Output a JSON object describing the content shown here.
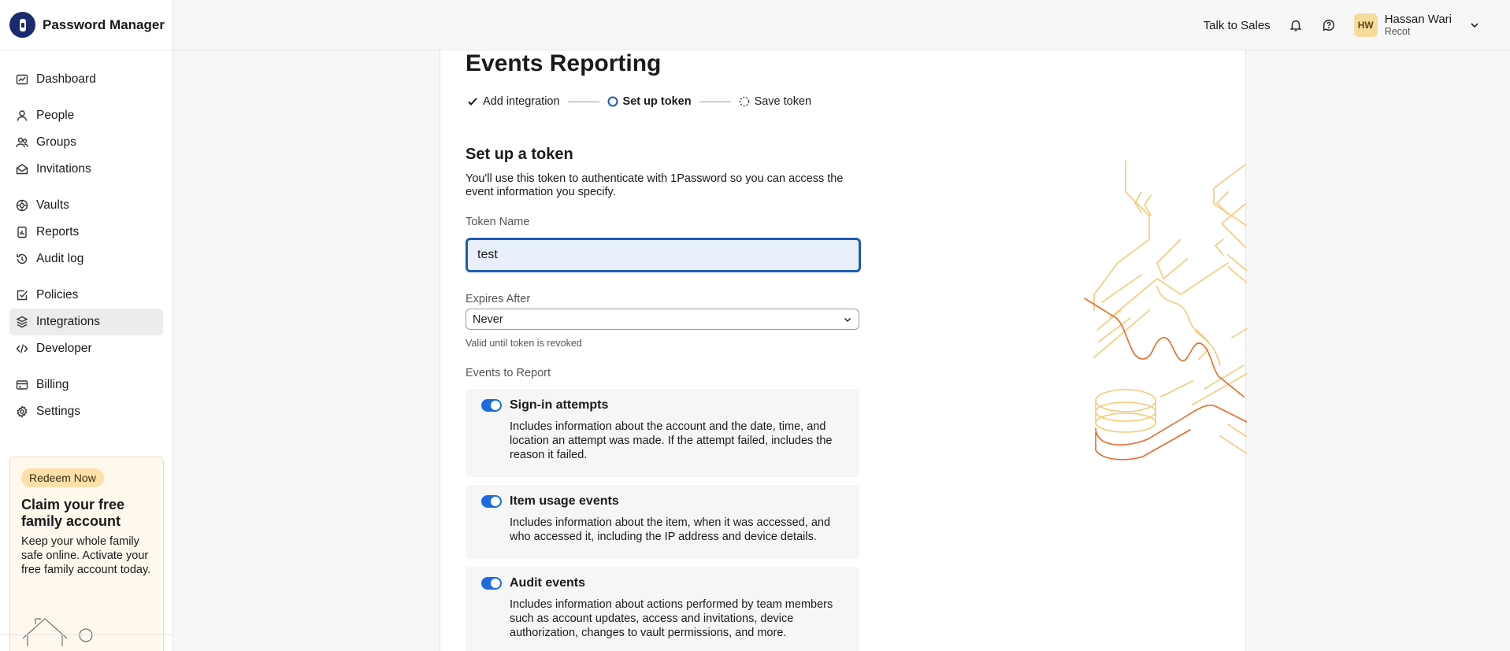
{
  "app": {
    "name": "Password Manager"
  },
  "sidebar": {
    "groups": [
      [
        {
          "label": "Dashboard",
          "icon": "dashboard-icon"
        }
      ],
      [
        {
          "label": "People",
          "icon": "person-icon"
        },
        {
          "label": "Groups",
          "icon": "group-icon"
        },
        {
          "label": "Invitations",
          "icon": "envelope-icon"
        }
      ],
      [
        {
          "label": "Vaults",
          "icon": "vault-icon"
        },
        {
          "label": "Reports",
          "icon": "report-icon"
        },
        {
          "label": "Audit log",
          "icon": "history-icon"
        }
      ],
      [
        {
          "label": "Policies",
          "icon": "checkbox-icon"
        },
        {
          "label": "Integrations",
          "icon": "integrations-icon",
          "active": true
        },
        {
          "label": "Developer",
          "icon": "code-icon"
        }
      ],
      [
        {
          "label": "Billing",
          "icon": "card-icon"
        },
        {
          "label": "Settings",
          "icon": "gear-icon"
        }
      ]
    ],
    "promo": {
      "badge": "Redeem Now",
      "title": "Claim your free family account",
      "text": "Keep your whole family safe online. Activate your free family account today."
    }
  },
  "topbar": {
    "talk_to_sales": "Talk to Sales",
    "user": {
      "initials": "HW",
      "name": "Hassan Wari",
      "org": "Recot"
    }
  },
  "main": {
    "title": "Events Reporting",
    "steps": [
      {
        "label": "Add integration",
        "state": "done"
      },
      {
        "label": "Set up token",
        "state": "current"
      },
      {
        "label": "Save token",
        "state": "pending"
      }
    ],
    "section_title": "Set up a token",
    "section_desc": "You'll use this token to authenticate with 1Password so you can access the event information you specify.",
    "token_name": {
      "label": "Token Name",
      "value": "test"
    },
    "expires": {
      "label": "Expires After",
      "value": "Never",
      "hint": "Valid until token is revoked"
    },
    "events_label": "Events to Report",
    "events": [
      {
        "title": "Sign-in attempts",
        "enabled": true,
        "desc": "Includes information about the account and the date, time, and location an attempt was made. If the attempt failed, includes the reason it failed."
      },
      {
        "title": "Item usage events",
        "enabled": true,
        "desc": "Includes information about the item, when it was accessed, and who accessed it, including the IP address and device details."
      },
      {
        "title": "Audit events",
        "enabled": true,
        "desc": "Includes information about actions performed by team members such as account updates, access and invitations, device authorization, changes to vault permissions, and more."
      }
    ]
  },
  "colors": {
    "accent": "#1f5ab7",
    "toggle": "#1f6bdc",
    "deco_orange": "#e8692a",
    "deco_yellow": "#f7c978"
  }
}
